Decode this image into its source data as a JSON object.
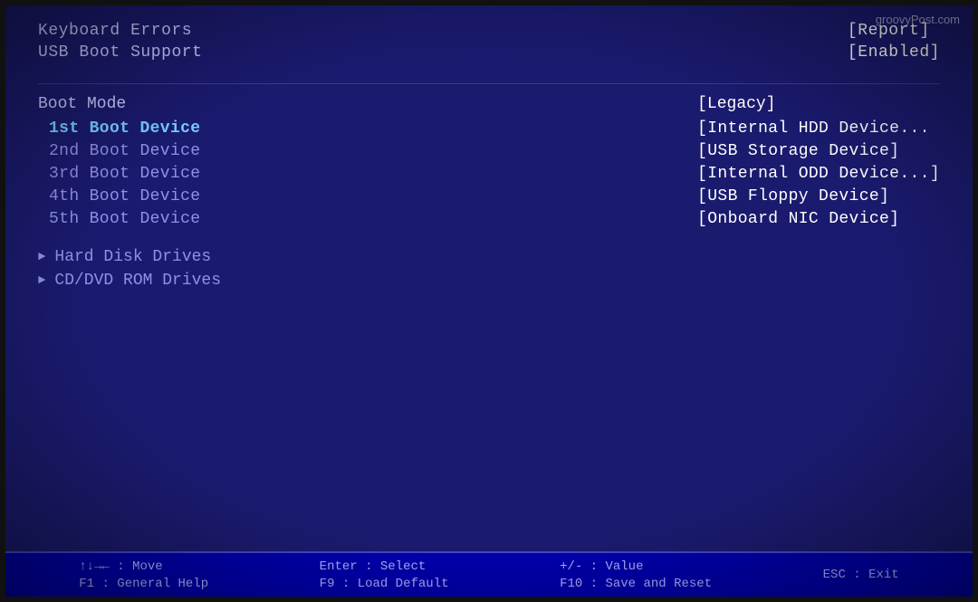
{
  "watermark": "groovyPost.com",
  "top": {
    "left_items": [
      {
        "label": "Keyboard Errors"
      },
      {
        "label": "USB Boot Support"
      }
    ],
    "right_items": [
      {
        "value": "[Report]"
      },
      {
        "value": "[Enabled]"
      }
    ]
  },
  "boot": {
    "mode_label": "Boot Mode",
    "mode_value": "[Legacy]",
    "devices": [
      {
        "label": "1st Boot Device",
        "selected": true
      },
      {
        "label": "2nd Boot Device",
        "selected": false
      },
      {
        "label": "3rd Boot Device",
        "selected": false
      },
      {
        "label": "4th Boot Device",
        "selected": false
      },
      {
        "label": "5th Boot Device",
        "selected": false
      }
    ],
    "values": [
      "[Internal HDD Device...",
      "[USB Storage Device]",
      "[Internal ODD Device...]",
      "[USB Floppy Device]",
      "[Onboard NIC Device]"
    ]
  },
  "submenus": [
    {
      "label": "Hard Disk Drives"
    },
    {
      "label": "CD/DVD ROM Drives"
    }
  ],
  "footer": {
    "col1_key": "↑↓→← : Move",
    "col1_sub": "F1 : General Help",
    "col2_key": "Enter : Select",
    "col2_sub": "F9 : Load Default",
    "col3_key": "+/- : Value",
    "col3_sub": "F10 : Save and Reset",
    "col4_key": "ESC : Exit",
    "col4_sub": ""
  }
}
